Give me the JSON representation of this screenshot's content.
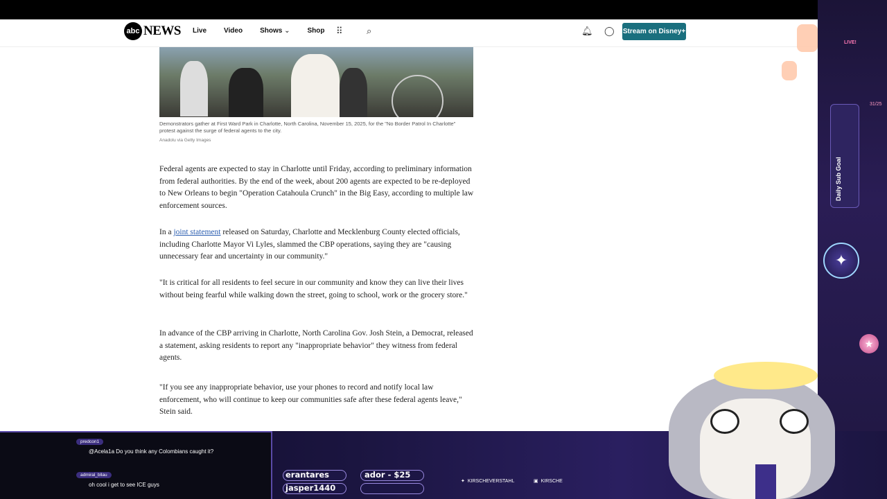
{
  "header": {
    "logo_mark": "abc",
    "logo_text": "NEWS",
    "nav": [
      "Live",
      "Video",
      "Shows",
      "Shop"
    ],
    "stream_button": "Stream on Disney+"
  },
  "article": {
    "caption": "Demonstrators gather at First Ward Park in Charlotte, North Carolina, November 15, 2025, for the \"No Border Patrol In Charlotte\" protest against the surge of federal agents to the city.",
    "credit": "Anadolu via Getty Images",
    "p1": "Federal agents are expected to stay in Charlotte until Friday, according to preliminary information from federal authorities. By the end of the week, about 200 agents are expected to be re-deployed to New Orleans to begin \"Operation Catahoula Crunch\" in the Big Easy, according to multiple law enforcement sources.",
    "p2_pre": "In a ",
    "p2_link": "joint statement",
    "p2_post": " released on Saturday, Charlotte and Mecklenburg County elected officials, including Charlotte Mayor Vi Lyles, slammed the CBP operations, saying they are \"causing unnecessary fear and uncertainty in our community.\"",
    "p3": "\"It is critical for all residents to feel secure in our community and know they can live their lives without being fearful while walking down the street, going to school, work or the grocery store.\"",
    "p4": "In advance of the CBP arriving in Charlotte, North Carolina Gov. Josh Stein, a Democrat, released a statement, asking residents to report any \"inappropriate behavior\" they witness from federal agents.",
    "p5": "\"If you see any inappropriate behavior, use your phones to record and notify local law enforcement, who will continue to keep our communities safe after these federal agents leave,\" Stein said."
  },
  "overlay": {
    "live_tag": "LIVE!",
    "goal_label": "Daily Sub Goal",
    "goal_count": "31/25",
    "chat": [
      {
        "user": "predcon1",
        "message": "@Acela1a Do you think any Colombians caught it?"
      },
      {
        "user": "admiral_bllau",
        "message": "oh cool i get to see ICE guys"
      }
    ],
    "ticker": [
      "erantares",
      "ador - $25",
      "jasper1440"
    ],
    "socials": [
      "KIRSCHEVERSTAHL",
      "KIRSCHE"
    ]
  }
}
